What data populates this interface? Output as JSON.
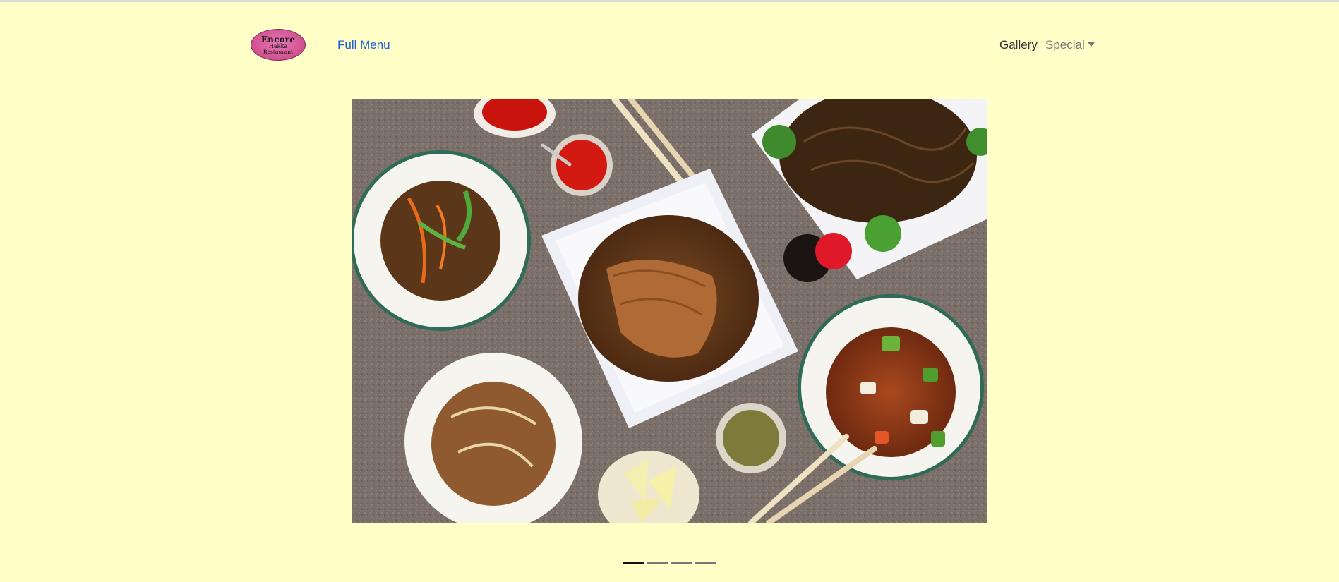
{
  "nav": {
    "logo": {
      "line1": "Encore",
      "line2": "Hakka",
      "line3": "Restaurant"
    },
    "full_menu_label": "Full Menu",
    "gallery_label": "Gallery",
    "special_label": "Special"
  },
  "carousel": {
    "slide_count": 4,
    "active_index": 0,
    "image_alt": "Overhead view of Hakka Chinese dishes: fried rice with roast chicken, noodles with broccoli, chili beef, sweet and sour chicken, fried chicken with onions, lemon wedges, sauces and chopsticks"
  },
  "colors": {
    "background": "#ffffc7",
    "link_blue": "#1a5fd6",
    "logo_pink": "#d0508f",
    "indicator_active": "#111111",
    "indicator_inactive": "#777777"
  }
}
